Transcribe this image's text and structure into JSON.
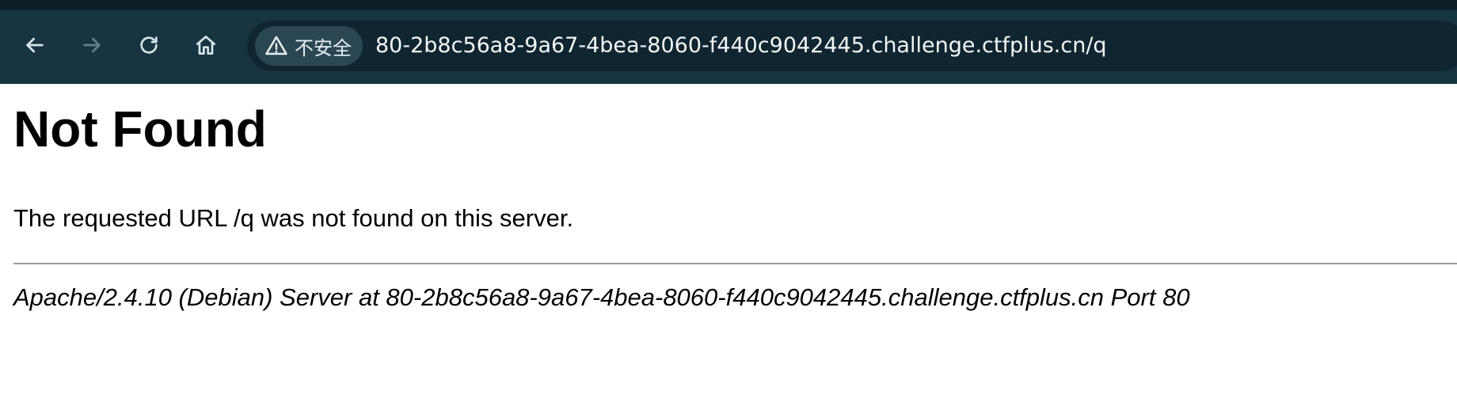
{
  "browser": {
    "security_label": "不安全",
    "url": "80-2b8c56a8-9a67-4bea-8060-f440c9042445.challenge.ctfplus.cn/q",
    "icons": {
      "back": "arrow-left-icon",
      "forward": "arrow-right-icon",
      "reload": "reload-icon",
      "home": "home-icon",
      "security": "warning-triangle-icon"
    },
    "colors": {
      "toolbar": "#173541",
      "omnibox": "#0f2530",
      "chip": "#2b4753"
    }
  },
  "page": {
    "title": "Not Found",
    "message": "The requested URL /q was not found on this server.",
    "server_signature": "Apache/2.4.10 (Debian) Server at 80-2b8c56a8-9a67-4bea-8060-f440c9042445.challenge.ctfplus.cn Port 80"
  }
}
